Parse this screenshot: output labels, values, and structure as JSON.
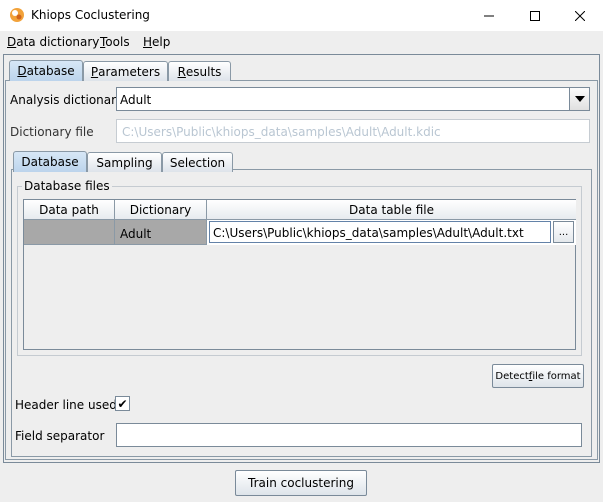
{
  "window": {
    "title": "Khiops Coclustering",
    "controls": [
      "minimize",
      "maximize",
      "close"
    ]
  },
  "menu": {
    "items": [
      {
        "underline": "D",
        "rest": "ata dictionary"
      },
      {
        "underline": "T",
        "rest": "ools"
      },
      {
        "underline": "H",
        "rest": "elp"
      }
    ]
  },
  "main_tabs": [
    {
      "underline": "D",
      "rest": "atabase",
      "active": true
    },
    {
      "underline": "P",
      "rest": "arameters",
      "active": false
    },
    {
      "underline": "R",
      "rest": "esults",
      "active": false
    }
  ],
  "analysis_dictionary": {
    "label": "Analysis dictionary",
    "value": "Adult"
  },
  "dictionary_file": {
    "label": "Dictionary file",
    "value": "C:\\Users\\Public\\khiops_data\\samples\\Adult\\Adult.kdic"
  },
  "sub_tabs": [
    {
      "label": "Database",
      "active": true
    },
    {
      "label": "Sampling",
      "active": false
    },
    {
      "label": "Selection",
      "active": false
    }
  ],
  "database_files": {
    "group_title": "Database files",
    "columns": [
      "Data path",
      "Dictionary",
      "Data table file"
    ],
    "rows": [
      {
        "data_path": "",
        "dictionary": "Adult",
        "data_table_file": "C:\\Users\\Public\\khiops_data\\samples\\Adult\\Adult.txt"
      }
    ],
    "browse_label": "..."
  },
  "detect_button": {
    "before": "Detect ",
    "underline": "f",
    "after": "ile format"
  },
  "header_line": {
    "label": "Header line used",
    "checked": true,
    "check_glyph": "✔"
  },
  "field_separator": {
    "label": "Field separator",
    "value": ""
  },
  "train_button": {
    "label": "Train coclustering"
  }
}
